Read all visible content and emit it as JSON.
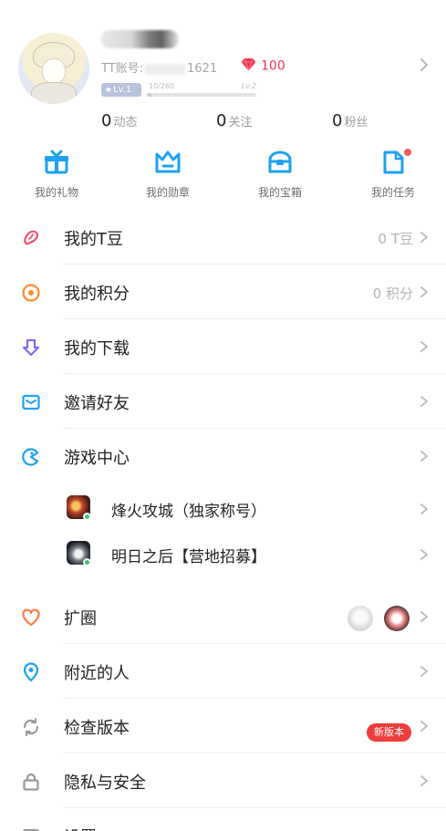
{
  "profile": {
    "tt_id_prefix": "TT账号:",
    "tt_id_suffix": "1621",
    "gems": "100",
    "level": "Lv.1",
    "xp_current": "10/260",
    "xp_next_level": "Lv.2",
    "xp_progress": 0.04
  },
  "stats": [
    {
      "value": "0",
      "label": "动态"
    },
    {
      "value": "0",
      "label": "关注"
    },
    {
      "value": "0",
      "label": "粉丝"
    }
  ],
  "quick_actions": [
    {
      "label": "我的礼物",
      "icon": "gift-icon"
    },
    {
      "label": "我的勋章",
      "icon": "crown-icon"
    },
    {
      "label": "我的宝箱",
      "icon": "treasure-chest-icon"
    },
    {
      "label": "我的任务",
      "icon": "task-icon",
      "has_dot": true
    }
  ],
  "menu": {
    "tdou": {
      "label": "我的T豆",
      "value": "0 T豆",
      "icon": "bean-icon"
    },
    "points": {
      "label": "我的积分",
      "value": "0 积分",
      "icon": "points-icon"
    },
    "downloads": {
      "label": "我的下载",
      "icon": "download-icon"
    },
    "invite": {
      "label": "邀请好友",
      "icon": "mail-icon"
    },
    "game_center": {
      "label": "游戏中心",
      "icon": "game-center-icon"
    },
    "games": [
      {
        "label": "烽火攻城（独家称号）"
      },
      {
        "label": "明日之后【营地招募】"
      }
    ],
    "expand_circle": {
      "label": "扩圈",
      "icon": "heart-icon"
    },
    "nearby": {
      "label": "附近的人",
      "icon": "location-pin-icon"
    },
    "check_version": {
      "label": "检查版本",
      "badge": "新版本",
      "icon": "refresh-icon"
    },
    "privacy": {
      "label": "隐私与安全",
      "icon": "lock-icon"
    },
    "settings": {
      "label": "设置",
      "icon": "settings-icon"
    }
  },
  "colors": {
    "accent_blue": "#1da1f2",
    "gem_red": "#f2334e",
    "badge_red": "#ee3d3d",
    "bean_red": "#f0506e",
    "points_orange": "#ff8a2a",
    "download_purple": "#7b6cf6",
    "heart_orange": "#ff7a45"
  }
}
